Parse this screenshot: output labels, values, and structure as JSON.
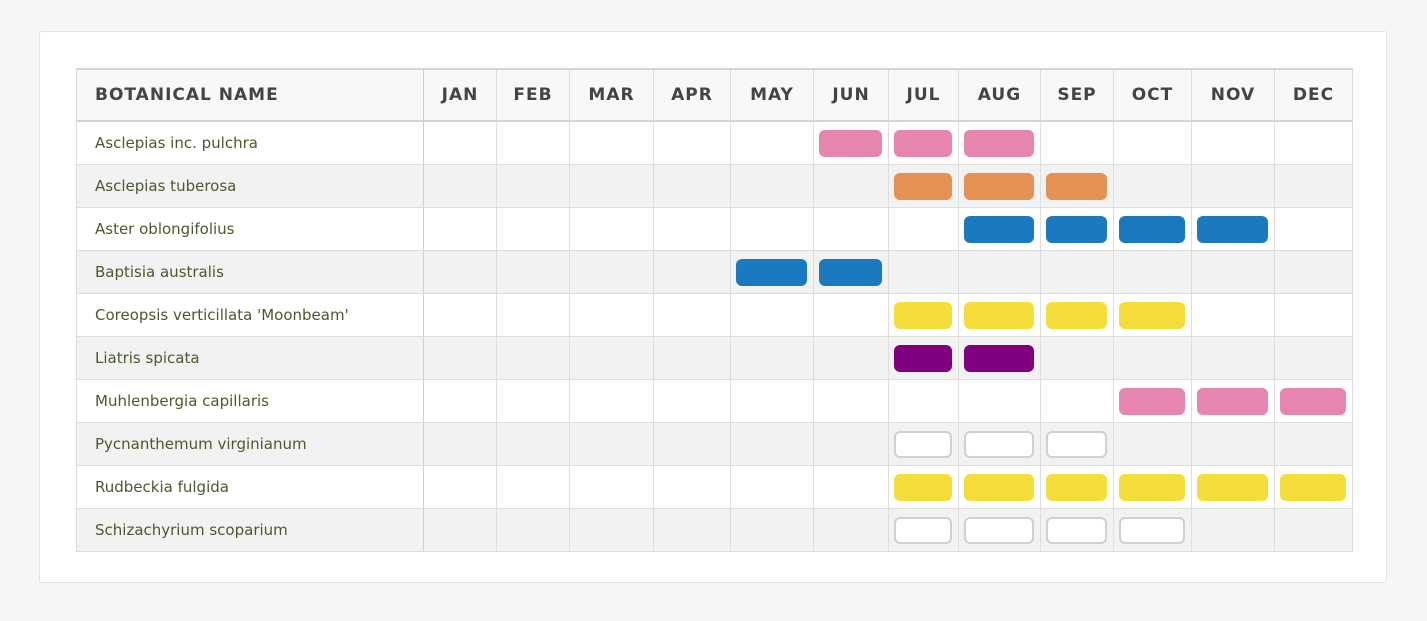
{
  "table": {
    "name_header": "BOTANICAL NAME",
    "months": [
      "JAN",
      "FEB",
      "MAR",
      "APR",
      "MAY",
      "JUN",
      "JUL",
      "AUG",
      "SEP",
      "OCT",
      "NOV",
      "DEC"
    ],
    "colors": {
      "pink": "#e585b0",
      "orange": "#e39254",
      "blue": "#1b79bf",
      "yellow": "#f5dd3c",
      "purple": "#800080",
      "white": "#ffffff"
    },
    "rows": [
      {
        "name": "Asclepias inc. pulchra",
        "color": "pink",
        "months": [
          5,
          6,
          7
        ]
      },
      {
        "name": "Asclepias tuberosa",
        "color": "orange",
        "months": [
          6,
          7,
          8
        ]
      },
      {
        "name": "Aster oblongifolius",
        "color": "blue",
        "months": [
          7,
          8,
          9,
          10
        ]
      },
      {
        "name": "Baptisia australis",
        "color": "blue",
        "months": [
          4,
          5
        ]
      },
      {
        "name": "Coreopsis verticillata 'Moonbeam'",
        "color": "yellow",
        "months": [
          6,
          7,
          8,
          9
        ]
      },
      {
        "name": "Liatris spicata",
        "color": "purple",
        "months": [
          6,
          7
        ]
      },
      {
        "name": "Muhlenbergia capillaris",
        "color": "pink",
        "months": [
          9,
          10,
          11
        ]
      },
      {
        "name": "Pycnanthemum virginianum",
        "color": "white",
        "months": [
          6,
          7,
          8
        ]
      },
      {
        "name": "Rudbeckia fulgida",
        "color": "yellow",
        "months": [
          6,
          7,
          8,
          9,
          10,
          11
        ]
      },
      {
        "name": "Schizachyrium scoparium",
        "color": "white",
        "months": [
          6,
          7,
          8,
          9
        ]
      }
    ]
  }
}
